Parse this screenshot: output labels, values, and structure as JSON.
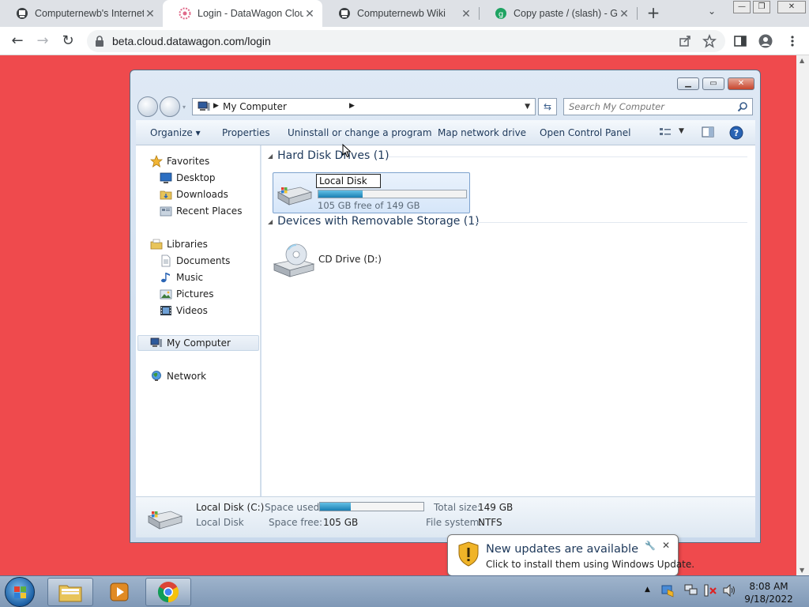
{
  "browser": {
    "tabs": [
      {
        "title": "Computernewb's Internet",
        "active": false,
        "icon": "computernewb-icon"
      },
      {
        "title": "Login - DataWagon Cloud",
        "active": true,
        "icon": "datawagon-icon"
      },
      {
        "title": "Computernewb Wiki",
        "active": false,
        "icon": "computernewb-icon"
      },
      {
        "title": "Copy paste / (slash) - Glyph",
        "active": false,
        "icon": "glyph-icon"
      }
    ],
    "url": "beta.cloud.datawagon.com/login",
    "new_tab": "+",
    "tab_menu": "⌄"
  },
  "explorer": {
    "breadcrumb": "My Computer",
    "search_placeholder": "Search My Computer",
    "commands": {
      "organize": "Organize ▾",
      "properties": "Properties",
      "uninstall": "Uninstall or change a program",
      "map_drive": "Map network drive",
      "control_panel": "Open Control Panel"
    },
    "nav": {
      "favorites": "Favorites",
      "desktop": "Desktop",
      "downloads": "Downloads",
      "recent": "Recent Places",
      "libraries": "Libraries",
      "documents": "Documents",
      "music": "Music",
      "pictures": "Pictures",
      "videos": "Videos",
      "computer": "My Computer",
      "network": "Network"
    },
    "groups": {
      "hdd": "Hard Disk Drives (1)",
      "removable": "Devices with Removable Storage (1)"
    },
    "local_disk": {
      "rename_value": "Local Disk",
      "free_text": "105 GB free of 149 GB",
      "used_fraction": 0.3
    },
    "cd_drive": "CD Drive (D:)",
    "details": {
      "name": "Local Disk (C:)",
      "type": "Local Disk",
      "space_used_label": "Space used:",
      "space_free_label": "Space free:",
      "space_free": "105 GB",
      "total_label": "Total size:",
      "total": "149 GB",
      "fs_label": "File system:",
      "fs": "NTFS",
      "used_fraction": 0.3
    }
  },
  "notification": {
    "title": "New updates are available",
    "message": "Click to install them using Windows Update."
  },
  "taskbar": {
    "time": "8:08 AM",
    "date": "9/18/2022"
  },
  "colors": {
    "page_background": "#ef4a4d",
    "chrome_tabbar": "#dee1e6",
    "explorer_link": "#1e395b"
  }
}
